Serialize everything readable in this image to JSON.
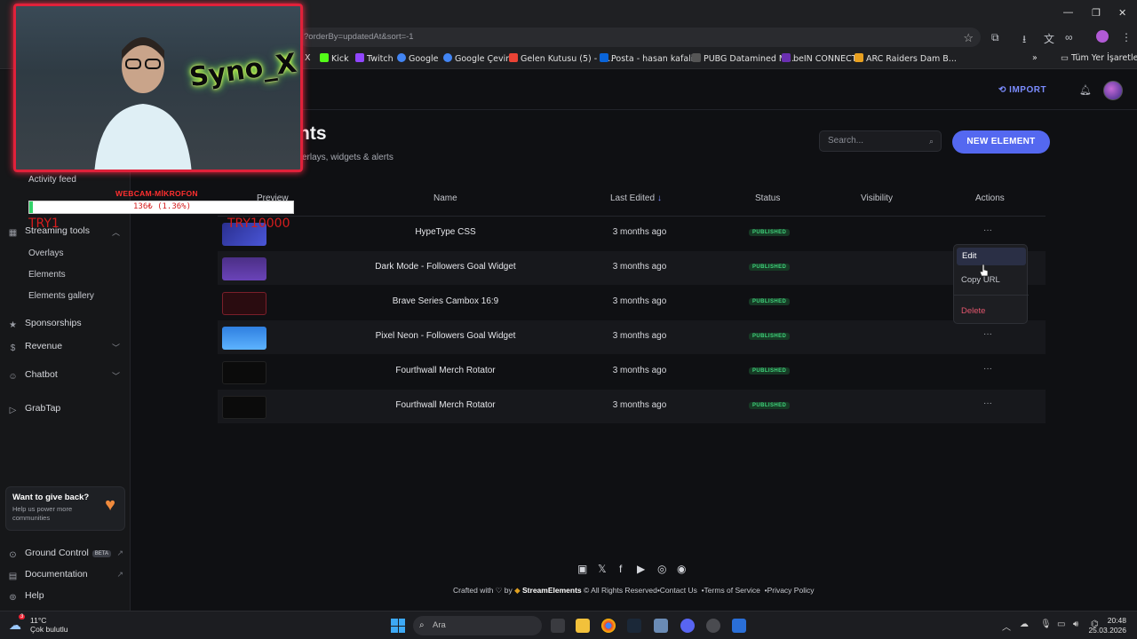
{
  "browser": {
    "url_fragment": "?orderBy=updatedAt&sort=-1",
    "bookmarks": [
      {
        "label": "X",
        "color": "#ffffff"
      },
      {
        "label": "Kick",
        "color": "#53fc18"
      },
      {
        "label": "Twitch",
        "color": "#9146ff"
      },
      {
        "label": "Google",
        "color": "#4285f4"
      },
      {
        "label": "Google Çeviri",
        "color": "#4285f4"
      },
      {
        "label": "Gelen Kutusu (5) - h...",
        "color": "#ea4335"
      },
      {
        "label": "Posta - hasan kafali...",
        "color": "#0a64d8"
      },
      {
        "label": "PUBG Datamined M...",
        "color": "#555555"
      },
      {
        "label": "beIN CONNECT",
        "color": "#6a2fb0"
      },
      {
        "label": "ARC Raiders Dam B...",
        "color": "#e8a020"
      }
    ],
    "more_bookmarks": "»",
    "all_bookmarks": "Tüm Yer İşaretleri"
  },
  "sidebar": {
    "activity_feed": "Activity feed",
    "streaming_tools": "Streaming tools",
    "overlays": "Overlays",
    "elements": "Elements",
    "elements_gallery": "Elements gallery",
    "sponsorships": "Sponsorships",
    "revenue": "Revenue",
    "chatbot": "Chatbot",
    "grabtap": "GrabTap",
    "giveback_title": "Want to give back?",
    "giveback_sub": "Help us power more communities",
    "ground_control": "Ground Control",
    "beta": "BETA",
    "documentation": "Documentation",
    "help": "Help"
  },
  "header": {
    "import": "IMPORT"
  },
  "page": {
    "title": "nts",
    "subtitle": "erlays, widgets & alerts",
    "search_placeholder": "Search...",
    "new_element": "NEW ELEMENT"
  },
  "table": {
    "columns": [
      "Preview",
      "Name",
      "Last Edited",
      "Status",
      "Visibility",
      "Actions"
    ],
    "sort_indicator": "↓",
    "rows": [
      {
        "name": "HypeType CSS",
        "edited": "3 months ago",
        "status": "PUBLISHED",
        "thumb": "#3b3fb5"
      },
      {
        "name": "Dark Mode - Followers Goal Widget",
        "edited": "3 months ago",
        "status": "PUBLISHED",
        "thumb": "#5a3a9a"
      },
      {
        "name": "Brave Series Cambox 16:9",
        "edited": "3 months ago",
        "status": "PUBLISHED",
        "thumb": "#3a1216"
      },
      {
        "name": "Pixel Neon - Followers Goal Widget",
        "edited": "3 months ago",
        "status": "PUBLISHED",
        "thumb": "#3a8fe8"
      },
      {
        "name": "Fourthwall Merch Rotator",
        "edited": "3 months ago",
        "status": "PUBLISHED",
        "thumb": "#0b0b0b"
      },
      {
        "name": "Fourthwall Merch Rotator",
        "edited": "3 months ago",
        "status": "PUBLISHED",
        "thumb": "#0b0b0b"
      }
    ],
    "row_actions": "···"
  },
  "context_menu": {
    "edit": "Edit",
    "copy_url": "Copy URL",
    "delete": "Delete"
  },
  "footer": {
    "crafted_with": "Crafted with",
    "by": "by",
    "brand": "StreamElements",
    "rights": "© All Rights Reserved",
    "contact": "•Contact Us",
    "terms": "•Terms of Service",
    "privacy": "•Privacy Policy"
  },
  "overlay": {
    "neon_sign": "Syno_X",
    "label": "WEBCAM-MİKROFON",
    "bar_text": "136₺ (1.36%)",
    "progress_pct": 1.36,
    "try1": "TRY1",
    "try2": "TRY10000"
  },
  "taskbar": {
    "temp": "11°C",
    "weather": "Çok bulutlu",
    "weather_badge": "3",
    "search": "Ara",
    "time": "20:48",
    "date": "25.03.2026"
  }
}
